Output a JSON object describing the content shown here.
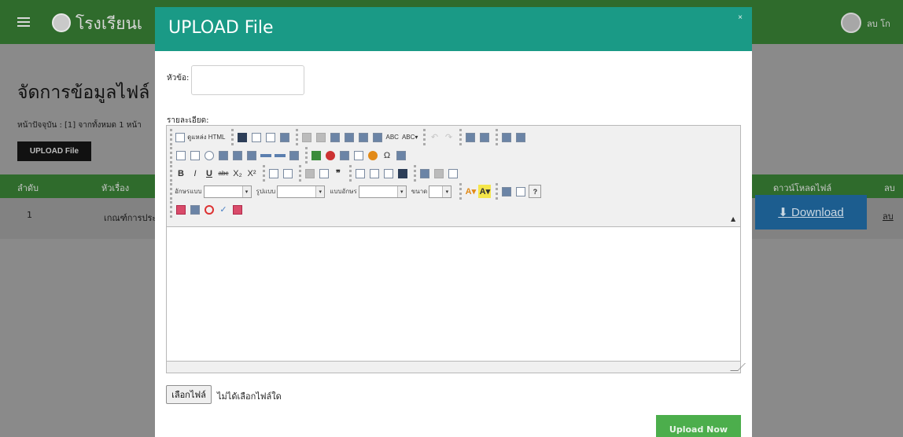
{
  "background": {
    "school_name": "โรงเรียนเ",
    "user_label": "ลบ โก",
    "page_title": "จัดการข้อมูลไฟล์",
    "pagination": "หน้าปัจจุบัน : [1] จากทั้งหมด 1 หน้า",
    "upload_button": "UPLOAD File",
    "table": {
      "headers": {
        "order": "ลำดับ",
        "subject": "หัวเรื่อง",
        "download": "ดาวน์โหลดไฟล์",
        "delete": "ลบ"
      },
      "rows": [
        {
          "order": "1",
          "subject": "เกณฑ์การประ",
          "download": "Download",
          "delete": "ลบ"
        }
      ]
    },
    "colors": {
      "header_green": "#2f6b2c"
    }
  },
  "modal": {
    "title": "UPLOAD File",
    "close": "×",
    "subject_label": "หัวข้อ:",
    "subject_value": "",
    "detail_label": "รายละเอียด:",
    "editor": {
      "source_label": "ดูแหล่ง HTML",
      "font_label": "อักษรแบบ",
      "format_label": "รูปแบบ",
      "style_label": "แบบอักษร",
      "size_label": "ขนาด",
      "bold": "B",
      "italic": "I",
      "underline": "U",
      "strike": "abc",
      "sub": "X₂",
      "sup": "X²",
      "font_color": "A",
      "bg_color": "A",
      "omega": "Ω",
      "quote": "❞",
      "help": "?",
      "collapse": "▲"
    },
    "file_button": "เลือกไฟล์",
    "file_status": "ไม่ได้เลือกไฟล์ใด",
    "submit": "Upload Now",
    "colors": {
      "header_teal": "#1a9a86",
      "submit_green": "#4cae4c"
    }
  }
}
